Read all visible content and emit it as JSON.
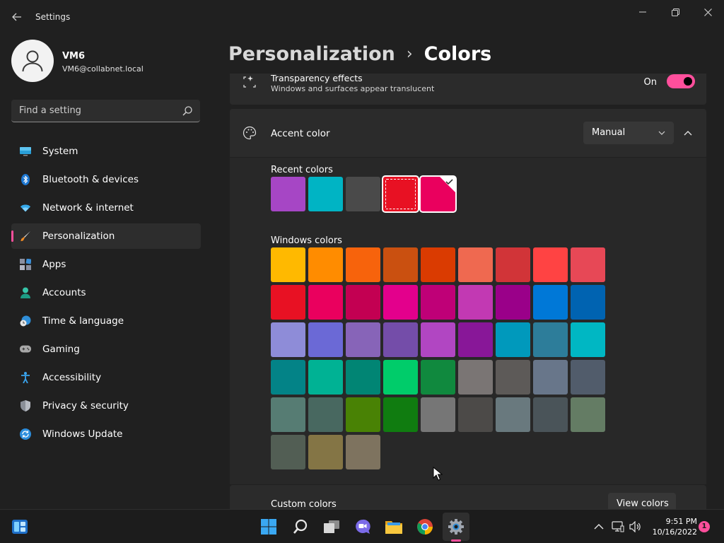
{
  "window": {
    "title": "Settings",
    "minimize_glyph": "—",
    "maximize_glyph": "❐",
    "close_glyph": "✕",
    "back_glyph": "←"
  },
  "profile": {
    "name": "VM6",
    "email": "VM6@collabnet.local"
  },
  "search": {
    "placeholder": "Find a setting"
  },
  "sidebar": {
    "items": [
      {
        "label": "System",
        "icon": "monitor-icon",
        "active": false
      },
      {
        "label": "Bluetooth & devices",
        "icon": "bluetooth-icon",
        "active": false
      },
      {
        "label": "Network & internet",
        "icon": "wifi-icon",
        "active": false
      },
      {
        "label": "Personalization",
        "icon": "brush-icon",
        "active": true
      },
      {
        "label": "Apps",
        "icon": "apps-icon",
        "active": false
      },
      {
        "label": "Accounts",
        "icon": "person-icon",
        "active": false
      },
      {
        "label": "Time & language",
        "icon": "globe-clock-icon",
        "active": false
      },
      {
        "label": "Gaming",
        "icon": "gamepad-icon",
        "active": false
      },
      {
        "label": "Accessibility",
        "icon": "accessibility-icon",
        "active": false
      },
      {
        "label": "Privacy & security",
        "icon": "shield-icon",
        "active": false
      },
      {
        "label": "Windows Update",
        "icon": "update-icon",
        "active": false
      }
    ],
    "accent": "#ff4f9c"
  },
  "breadcrumb": {
    "parent": "Personalization",
    "separator": "›",
    "current": "Colors"
  },
  "transparency": {
    "title": "Transparency effects",
    "description": "Windows and surfaces appear translucent",
    "state_label": "On",
    "on": true
  },
  "accent": {
    "title": "Accent color",
    "mode": "Manual",
    "recent_label": "Recent colors",
    "recent_colors": [
      "#a646c5",
      "#00b4c4",
      "#4a4a4a",
      "#e81123",
      "#ea005e"
    ],
    "outlined_index": 3,
    "selected_index": 4,
    "windows_label": "Windows colors",
    "windows_colors": [
      [
        "#ffb900",
        "#ff8c00",
        "#f7630c",
        "#ca5010",
        "#da3b01",
        "#ef6950",
        "#d13438",
        "#ff4343",
        "#e74856"
      ],
      [
        "#e81123",
        "#ea005e",
        "#c30052",
        "#e3008c",
        "#bf0077",
        "#c239b3",
        "#9a0089",
        "#0078d7",
        "#0063b1"
      ],
      [
        "#8e8cd8",
        "#6b69d6",
        "#8764b8",
        "#744da9",
        "#b146c2",
        "#881798",
        "#0099bc",
        "#2d7d9a",
        "#00b7c3"
      ],
      [
        "#038387",
        "#00b294",
        "#018574",
        "#00cc6a",
        "#10893e",
        "#7a7574",
        "#5d5a58",
        "#68768a",
        "#515c6b"
      ],
      [
        "#567c73",
        "#486860",
        "#498205",
        "#107c10",
        "#767676",
        "#4c4a48",
        "#69797e",
        "#4a5459",
        "#647c64"
      ],
      [
        "#525e54",
        "#847545",
        "#7e735f"
      ]
    ]
  },
  "custom": {
    "label": "Custom colors",
    "button": "View colors"
  },
  "taskbar": {
    "time": "9:51 PM",
    "date": "10/16/2022",
    "notification_count": "1"
  }
}
